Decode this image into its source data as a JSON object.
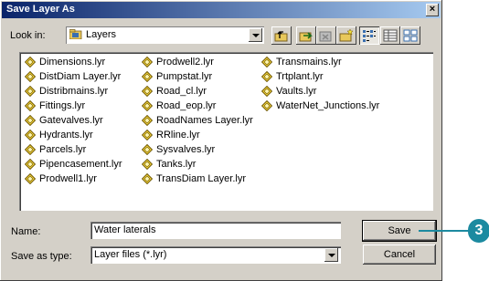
{
  "dialog": {
    "title": "Save Layer As",
    "close_glyph": "×"
  },
  "lookin": {
    "label": "Look in:",
    "value": "Layers",
    "icon": "folder-layers-icon"
  },
  "toolbar": {
    "buttons": [
      {
        "name": "up-one-level-icon"
      },
      {
        "name": "add-connection-icon"
      },
      {
        "name": "disconnect-icon"
      },
      {
        "name": "new-folder-icon"
      },
      {
        "name": "list-view-icon",
        "pressed": true
      },
      {
        "name": "details-view-icon"
      },
      {
        "name": "thumbnails-view-icon"
      }
    ]
  },
  "files": {
    "columns": [
      [
        "Dimensions.lyr",
        "DistDiam Layer.lyr",
        "Distribmains.lyr",
        "Fittings.lyr",
        "Gatevalves.lyr",
        "Hydrants.lyr",
        "Parcels.lyr",
        "Pipencasement.lyr",
        "Prodwell1.lyr"
      ],
      [
        "Prodwell2.lyr",
        "Pumpstat.lyr",
        "Road_cl.lyr",
        "Road_eop.lyr",
        "RoadNames Layer.lyr",
        "RRline.lyr",
        "Sysvalves.lyr",
        "Tanks.lyr",
        "TransDiam Layer.lyr"
      ],
      [
        "Transmains.lyr",
        "Trtplant.lyr",
        "Vaults.lyr",
        "WaterNet_Junctions.lyr"
      ]
    ]
  },
  "name_field": {
    "label": "Name:",
    "value": "Water laterals"
  },
  "type_field": {
    "label": "Save as type:",
    "value": "Layer files (*.lyr)"
  },
  "buttons": {
    "save": "Save",
    "cancel": "Cancel"
  },
  "callout": {
    "number": "3"
  },
  "colors": {
    "callout": "#1c8aa0",
    "title_start": "#0a246a",
    "title_end": "#a6caf0"
  }
}
